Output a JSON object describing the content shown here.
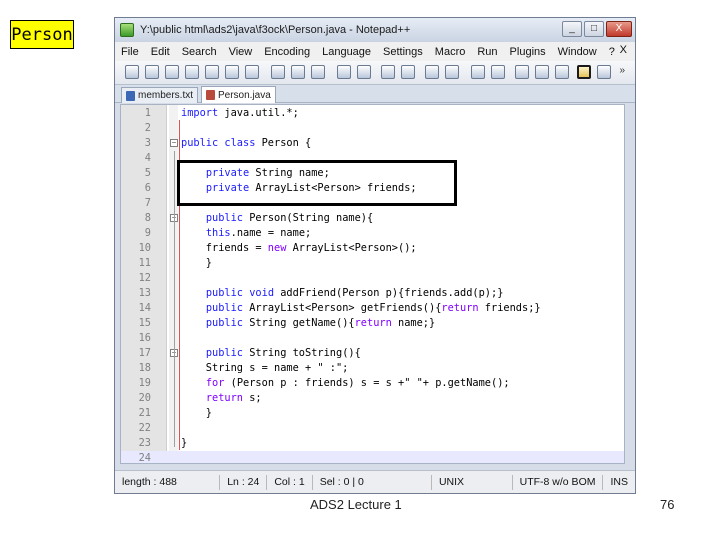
{
  "slide": {
    "title": "Person",
    "footer": "ADS2 Lecture 1",
    "page_number": "76"
  },
  "window": {
    "title": "Y:\\public html\\ads2\\java\\f3ock\\Person.java - Notepad++",
    "controls": [
      "_",
      "□",
      "X"
    ]
  },
  "menu": {
    "items": [
      "File",
      "Edit",
      "Search",
      "View",
      "Encoding",
      "Language",
      "Settings",
      "Macro",
      "Run",
      "Plugins",
      "Window",
      "?"
    ],
    "close": "X"
  },
  "tabs": [
    {
      "label": "members.txt",
      "active": false
    },
    {
      "label": "Person.java",
      "active": true
    }
  ],
  "editor": {
    "lines": [
      {
        "n": "1",
        "code": "import java.util.*;"
      },
      {
        "n": "2",
        "code": ""
      },
      {
        "n": "3",
        "code": "public class Person {"
      },
      {
        "n": "4",
        "code": ""
      },
      {
        "n": "5",
        "code": "    private String name;"
      },
      {
        "n": "6",
        "code": "    private ArrayList<Person> friends;"
      },
      {
        "n": "7",
        "code": ""
      },
      {
        "n": "8",
        "code": "    public Person(String name){"
      },
      {
        "n": "9",
        "code": "    this.name = name;"
      },
      {
        "n": "10",
        "code": "    friends = new ArrayList<Person>();"
      },
      {
        "n": "11",
        "code": "    }"
      },
      {
        "n": "12",
        "code": ""
      },
      {
        "n": "13",
        "code": "    public void addFriend(Person p){friends.add(p);}"
      },
      {
        "n": "14",
        "code": "    public ArrayList<Person> getFriends(){return friends;}"
      },
      {
        "n": "15",
        "code": "    public String getName(){return name;}"
      },
      {
        "n": "16",
        "code": ""
      },
      {
        "n": "17",
        "code": "    public String toString(){"
      },
      {
        "n": "18",
        "code": "    String s = name + \" :\";"
      },
      {
        "n": "19",
        "code": "    for (Person p : friends) s = s +\" \"+ p.getName();"
      },
      {
        "n": "20",
        "code": "    return s;"
      },
      {
        "n": "21",
        "code": "    }"
      },
      {
        "n": "22",
        "code": ""
      },
      {
        "n": "23",
        "code": "}"
      },
      {
        "n": "24",
        "code": ""
      }
    ],
    "current_line": "24"
  },
  "status": {
    "length": "length : 488",
    "ln": "Ln : 24",
    "col": "Col : 1",
    "sel": "Sel : 0 | 0",
    "eol": "UNIX",
    "encoding": "UTF-8 w/o BOM",
    "mode": "INS"
  }
}
